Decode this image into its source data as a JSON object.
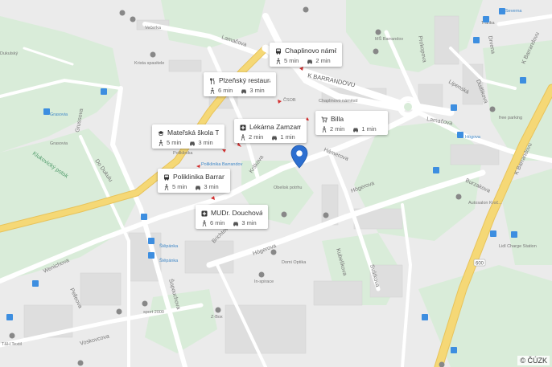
{
  "map": {
    "attribution": "© ČÚZK",
    "streets": [
      {
        "key": "lamacova_1",
        "text": "Lamačova"
      },
      {
        "key": "lamacova_2",
        "text": "Lamačova"
      },
      {
        "key": "barrandov",
        "text": "K BARRANDOVU"
      },
      {
        "key": "hamerova",
        "text": "Hámerova"
      },
      {
        "key": "krskova",
        "text": "Krškova"
      },
      {
        "key": "hogerova_1",
        "text": "Högerova"
      },
      {
        "key": "hogerova_2",
        "text": "Högerova"
      },
      {
        "key": "kubelikova",
        "text": "Kubelíkova"
      },
      {
        "key": "svatkova",
        "text": "Svátkova"
      },
      {
        "key": "brichtova",
        "text": "Brichtova"
      },
      {
        "key": "sopouchova",
        "text": "Šopouchova"
      },
      {
        "key": "wenichova",
        "text": "Wenichova"
      },
      {
        "key": "pelleova",
        "text": "Pelleova"
      },
      {
        "key": "voskovcova",
        "text": "Voskovcova"
      },
      {
        "key": "gruzmova",
        "text": "Grussova"
      },
      {
        "key": "dudlikova",
        "text": "Dudlikova"
      },
      {
        "key": "prokopova",
        "text": "Prokopova"
      },
      {
        "key": "lipenska",
        "text": "Lipenská"
      },
      {
        "key": "burzakova",
        "text": "Burzakova"
      },
      {
        "key": "kbarrandovu",
        "text": "K Barrandovu"
      },
      {
        "key": "drvena",
        "text": "Drvena"
      },
      {
        "key": "dukulu",
        "text": "Do Dukulu"
      },
      {
        "key": "klukovicky",
        "text": "Klukovický potok"
      },
      {
        "key": "k_barrandovu_2",
        "text": "K Barrandovu"
      }
    ],
    "places": [
      {
        "key": "vecerka",
        "text": "Večerka"
      },
      {
        "key": "krista",
        "text": "Krista spasitele"
      },
      {
        "key": "grasovia",
        "text": "Grasovia"
      },
      {
        "key": "grasovia2",
        "text": "Grasovia"
      },
      {
        "key": "ms_barrandov",
        "text": "MŠ Barrandov"
      },
      {
        "key": "trafika",
        "text": "Trafika"
      },
      {
        "key": "severa",
        "text": "Severna"
      },
      {
        "key": "chaplinovo",
        "text": "Chaplinovo náměstí"
      },
      {
        "key": "csob",
        "text": "ČSOB"
      },
      {
        "key": "poliklinika_barrandov",
        "text": "Poliklinika Barrandov"
      },
      {
        "key": "poliklinika",
        "text": "Poliklinika"
      },
      {
        "key": "obelisk",
        "text": "Obelisk potrhu"
      },
      {
        "key": "free_parking",
        "text": "free parking"
      },
      {
        "key": "hogova",
        "text": "Högova"
      },
      {
        "key": "autosalon",
        "text": "Autosalon Kroč..."
      },
      {
        "key": "lidl",
        "text": "Lidl Charge Station"
      },
      {
        "key": "stepanka",
        "text": "Štěpánka"
      },
      {
        "key": "stepanka2",
        "text": "Štěpánka"
      },
      {
        "key": "domi",
        "text": "Domi Optika"
      },
      {
        "key": "inspirace",
        "text": "In-spirace"
      },
      {
        "key": "sport2000",
        "text": "sport 2000"
      },
      {
        "key": "zbox",
        "text": "Z-Box"
      },
      {
        "key": "th_textil",
        "text": "T&H Textil"
      },
      {
        "key": "dukulski",
        "text": "Dukulský"
      }
    ],
    "road_numbers": [
      "600"
    ],
    "pin": {
      "color": "#2d6fd0"
    }
  },
  "pois": [
    {
      "id": "chaplinovo",
      "icon": "bus-icon",
      "name": "Chaplinovo námě...",
      "walk": "5 min",
      "drive": "2 min"
    },
    {
      "id": "plzensky",
      "icon": "restaurant-icon",
      "name": "Plzeňský restaura...",
      "walk": "6 min",
      "drive": "3 min"
    },
    {
      "id": "billa",
      "icon": "cart-icon",
      "name": "Billa",
      "walk": "2 min",
      "drive": "1 min"
    },
    {
      "id": "lekarna",
      "icon": "cross-icon",
      "name": "Lékárna Zamzam",
      "walk": "2 min",
      "drive": "1 min"
    },
    {
      "id": "materska",
      "icon": "school-icon",
      "name": "Mateřská škola T...",
      "walk": "5 min",
      "drive": "3 min"
    },
    {
      "id": "poliklinika",
      "icon": "bus-icon",
      "name": "Poliklinika Barran...",
      "walk": "5 min",
      "drive": "3 min"
    },
    {
      "id": "mudr",
      "icon": "cross-icon",
      "name": "MUDr. Douchová ...",
      "walk": "6 min",
      "drive": "3 min"
    }
  ],
  "colors": {
    "road_major": "#f3d26a",
    "road": "#ffffff",
    "green": "#d5ebd5",
    "pin": "#2d6fd0",
    "poi_marker": "#d32f2f"
  }
}
